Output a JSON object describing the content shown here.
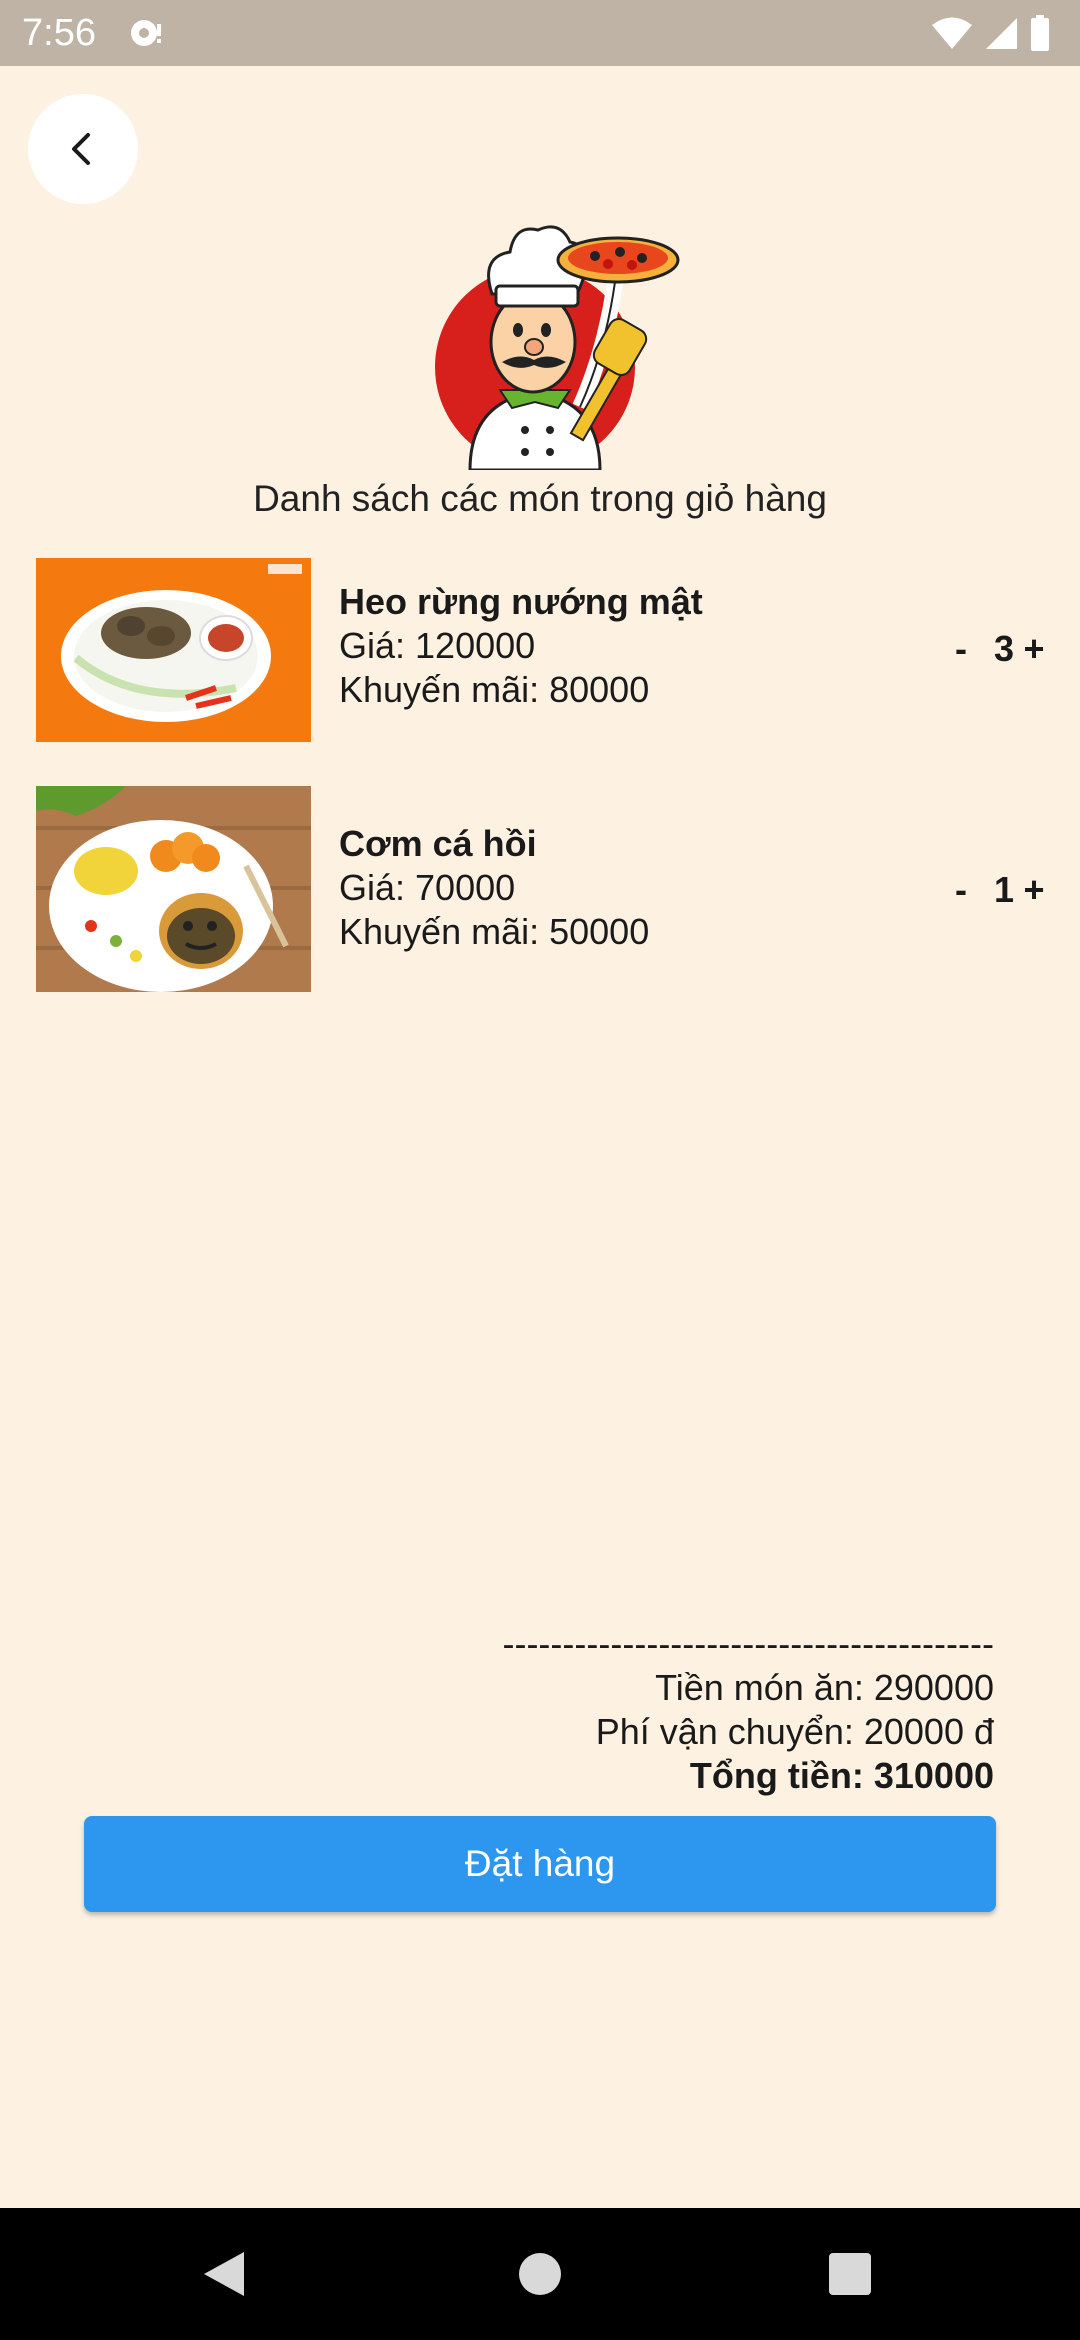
{
  "status_bar": {
    "time": "7:56",
    "icons": [
      "notification-icon",
      "wifi-icon",
      "cellular-signal-icon",
      "battery-icon"
    ]
  },
  "back_button": {
    "icon": "chevron-left-icon"
  },
  "logo": {
    "icon": "chef-pizza-logo"
  },
  "title": "Danh sách các món trong giỏ hàng",
  "items": [
    {
      "name": "Heo rừng nướng mật",
      "price_text": "Giá: 120000",
      "promo_text": "Khuyến mãi: 80000",
      "minus": "-",
      "quantity": "3",
      "plus": "+",
      "thumb_color": "#f47a10"
    },
    {
      "name": "Cơm cá hồi",
      "price_text": "Giá: 70000",
      "promo_text": "Khuyến mãi: 50000",
      "minus": "-",
      "quantity": "1",
      "plus": "+",
      "thumb_color": "#b07a4c"
    }
  ],
  "summary": {
    "divider": "-----------------------------------------",
    "food_total": "Tiền món ăn: 290000",
    "shipping": "Phí vận chuyển: 20000 đ",
    "grand_total": "Tổng tiền: 310000"
  },
  "order_button": {
    "label": "Đặt hàng",
    "color": "#2d96ef"
  },
  "colors": {
    "background": "#fdf1e2",
    "status_bar": "#bfb3a5",
    "nav_bar": "#000000"
  },
  "nav_bar": {
    "icons": [
      "back-triangle-icon",
      "home-circle-icon",
      "recents-square-icon"
    ]
  }
}
